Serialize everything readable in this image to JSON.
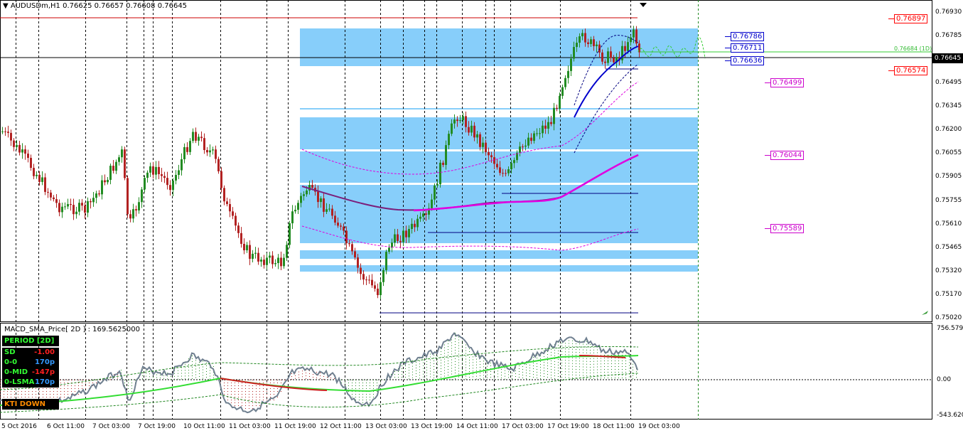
{
  "main_chart": {
    "title": "AUDUSDm,H1",
    "ohlc": "0.76625 0.76657 0.76608 0.76645",
    "price_axis": [
      "0.76930",
      "0.76785",
      "0.76640",
      "0.76495",
      "0.76345",
      "0.76200",
      "0.76055",
      "0.75905",
      "0.75755",
      "0.75610",
      "0.75465",
      "0.75320",
      "0.75170",
      "0.75020"
    ],
    "current_price": "0.76645",
    "right_levels": [
      {
        "text": "0.76897",
        "color": "#ff0000"
      },
      {
        "text": "0.76574",
        "color": "#ff0000"
      },
      {
        "text": "0.76499",
        "color": "#cc00cc"
      },
      {
        "text": "0.76044",
        "color": "#cc00cc"
      },
      {
        "text": "0.75589",
        "color": "#cc00cc"
      }
    ],
    "blue_levels": [
      "0.76786",
      "0.76711",
      "0.76636"
    ],
    "projection_label": "0.76684 (1D)"
  },
  "indicator": {
    "title": "MACD_SMA_Price[ 2D ] : 169.5625000",
    "axis": [
      "756.5791",
      "0.00",
      "-543.6200"
    ],
    "panel": {
      "period": "PERIOD [2D]",
      "rows": [
        {
          "key": "SD",
          "value": "-1.00",
          "color": "#ff2020"
        },
        {
          "key": "0-0",
          "value": "170p",
          "color": "#3399ff"
        },
        {
          "key": "0-MID",
          "value": "-147p",
          "color": "#ff2020"
        },
        {
          "key": "0-LSMA",
          "value": "170p",
          "color": "#3399ff"
        }
      ],
      "signal": "KTI DOWN"
    }
  },
  "time_axis": [
    "5 Oct 2016",
    "6 Oct 11:00",
    "7 Oct 03:00",
    "7 Oct 19:00",
    "10 Oct 11:00",
    "11 Oct 03:00",
    "11 Oct 19:00",
    "12 Oct 11:00",
    "13 Oct 03:00",
    "13 Oct 19:00",
    "14 Oct 11:00",
    "17 Oct 03:00",
    "17 Oct 19:00",
    "18 Oct 11:00",
    "19 Oct 03:00"
  ]
}
